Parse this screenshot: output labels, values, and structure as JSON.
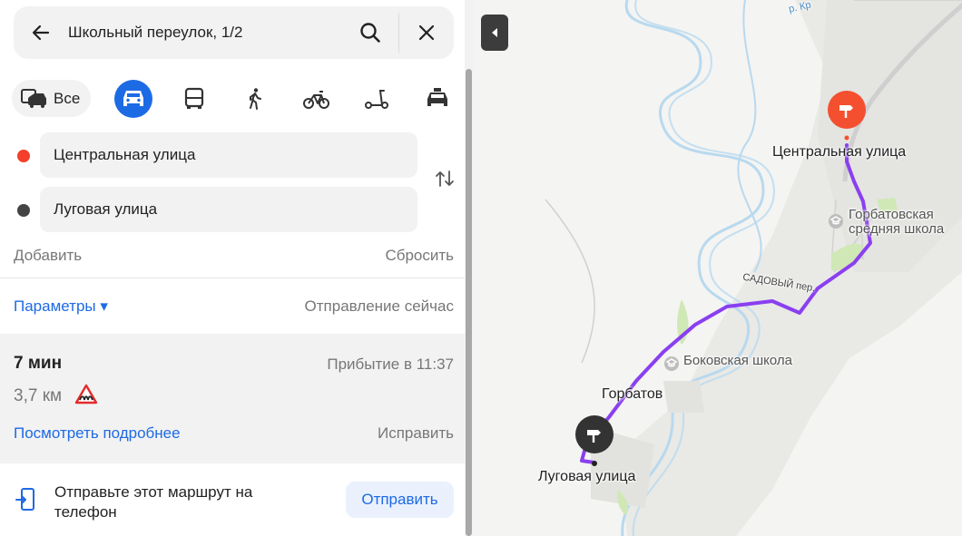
{
  "search": {
    "query": "Школьный переулок, 1/2"
  },
  "modes": {
    "all_label": "Все",
    "items": [
      "car-icon",
      "bus-icon",
      "walk-icon",
      "bike-icon",
      "scooter-icon",
      "taxi-icon"
    ],
    "active": "car-icon"
  },
  "points": {
    "from": {
      "label": "Центральная улица",
      "color": "#f43f2a"
    },
    "to": {
      "label": "Луговая улица",
      "color": "#444444"
    }
  },
  "actions": {
    "add": "Добавить",
    "reset": "Сбросить"
  },
  "params": {
    "label": "Параметры ▾",
    "departure": "Отправление сейчас"
  },
  "route": {
    "time": "7 мин",
    "arrival": "Прибытие в 11:37",
    "distance": "3,7 км",
    "details_link": "Посмотреть подробнее",
    "fix_link": "Исправить"
  },
  "send": {
    "text": "Отправьте этот маршрут на телефон",
    "button": "Отправить"
  },
  "map": {
    "labels": {
      "start": "Центральная улица",
      "school1_line1": "Горбатовская",
      "school1_line2": "средняя школа",
      "street": "САДОВЫЙ пер.",
      "school2": "Боковская школа",
      "village": "Горбатов",
      "end": "Луговая улица",
      "river": "р. Кр"
    },
    "route_color": "#8a3ff0",
    "start_pin_color": "#f4502f",
    "end_pin_color": "#333333"
  }
}
